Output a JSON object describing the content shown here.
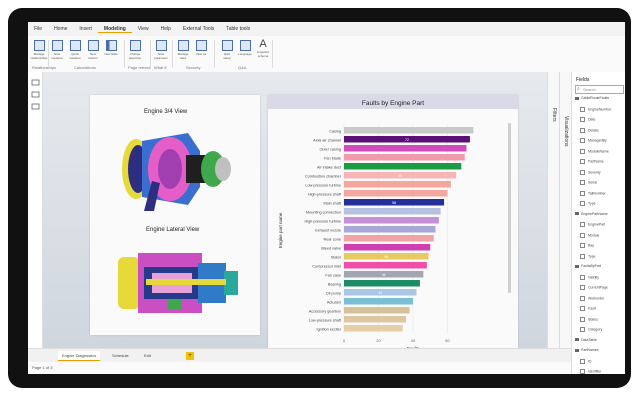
{
  "menu": {
    "items": [
      "File",
      "Home",
      "Insert",
      "Modeling",
      "View",
      "Help",
      "External Tools",
      "Table tools"
    ],
    "active_index": 3
  },
  "ribbon": {
    "buttons": [
      {
        "label": "Manage relationships",
        "icon": "relationships-icon"
      },
      {
        "label": "New measure",
        "icon": "calculator-icon"
      },
      {
        "label": "Quick measure",
        "icon": "calculator-icon"
      },
      {
        "label": "New column",
        "icon": "column-icon"
      },
      {
        "label": "New table",
        "icon": "table-icon"
      },
      {
        "label": "Change detection",
        "icon": "detect-icon"
      },
      {
        "label": "New parameter",
        "icon": "parameter-icon"
      },
      {
        "label": "Manage roles",
        "icon": "roles-icon"
      },
      {
        "label": "View as",
        "icon": "view-icon"
      },
      {
        "label": "Q&A setup",
        "icon": "qa-icon"
      },
      {
        "label": "Language",
        "icon": "language-icon"
      },
      {
        "label": "Linguistic schema",
        "icon": "text-icon"
      }
    ],
    "groups": [
      "Relationships",
      "Calculations",
      "Page refresh",
      "What if",
      "Security",
      "Q&A"
    ]
  },
  "report": {
    "left_card": {
      "title_top": "Engine 3/4 View",
      "title_bottom": "Engine Lateral View"
    }
  },
  "panes": {
    "filters_label": "Filters",
    "visualizations_label": "Visualizations",
    "fields_title": "Fields",
    "search_placeholder": "Search",
    "fields": [
      {
        "name": "CableRouteFaults",
        "kind": "table"
      },
      {
        "name": "EngineNumber",
        "kind": "field"
      },
      {
        "name": "Date",
        "kind": "field"
      },
      {
        "name": "Details",
        "kind": "field"
      },
      {
        "name": "ManagedBy",
        "kind": "field"
      },
      {
        "name": "ModuleName",
        "kind": "field"
      },
      {
        "name": "PartName",
        "kind": "field"
      },
      {
        "name": "Severity",
        "kind": "field"
      },
      {
        "name": "Serial",
        "kind": "field"
      },
      {
        "name": "TailNumber",
        "kind": "field"
      },
      {
        "name": "Type",
        "kind": "field"
      },
      {
        "name": "EnginePartName",
        "kind": "table"
      },
      {
        "name": "EnginePart",
        "kind": "field"
      },
      {
        "name": "Module",
        "kind": "field"
      },
      {
        "name": "Bay",
        "kind": "field"
      },
      {
        "name": "Type",
        "kind": "field"
      },
      {
        "name": "FaultsByPart",
        "kind": "table"
      },
      {
        "name": "Validity",
        "kind": "field"
      },
      {
        "name": "CurrentPage",
        "kind": "field"
      },
      {
        "name": "Workorder",
        "kind": "field"
      },
      {
        "name": "Fault",
        "kind": "field"
      },
      {
        "name": "Status",
        "kind": "field"
      },
      {
        "name": "Category",
        "kind": "field"
      },
      {
        "name": "DataTable",
        "kind": "table"
      },
      {
        "name": "PartNames",
        "kind": "table"
      },
      {
        "name": "ID",
        "kind": "field"
      },
      {
        "name": "Identifier",
        "kind": "field"
      }
    ]
  },
  "tabs": {
    "items": [
      "Engine Diagnostics",
      "Schedule",
      "Edit"
    ],
    "active_index": 0,
    "add_label": "+"
  },
  "status": {
    "page_text": "Page 1 of 3"
  },
  "chart_data": {
    "type": "bar",
    "orientation": "horizontal",
    "title": "Faults by Engine Part",
    "xlabel": "Faults",
    "ylabel": "Engine part name",
    "xlim": [
      0,
      80
    ],
    "x_ticks": [
      0,
      20,
      40,
      60
    ],
    "categories": [
      "Casing",
      "Axial air channel",
      "Outer casing",
      "Fan blade",
      "Air intake duct",
      "Combustion chamber",
      "Low-pressure turbine",
      "High-pressure shaft",
      "Main shaft",
      "Mounting connection",
      "High-pressure turbine",
      "Exhaust nozzle",
      "Rear cone",
      "Bleed valve",
      "Stator",
      "Compressor inlet",
      "Fan case",
      "Bearing",
      "Oil pump",
      "Actuator",
      "Accessory gearbox",
      "Low-pressure shaft",
      "Ignition exciter"
    ],
    "values": [
      75,
      73,
      71,
      70,
      68,
      65,
      62,
      60,
      58,
      56,
      55,
      53,
      52,
      50,
      49,
      48,
      46,
      44,
      42,
      40,
      38,
      36,
      34
    ],
    "data_labels": {
      "1": "72",
      "5": "65",
      "8": "58",
      "14": "49",
      "16": "46",
      "18": "42"
    },
    "colors": [
      "#c8c9cb",
      "#5b1079",
      "#d24bbd",
      "#f29aac",
      "#1c9a46",
      "#f7b5b5",
      "#f5a79c",
      "#f2a8a0",
      "#23309c",
      "#b7c2e0",
      "#c78fd6",
      "#a9a7d8",
      "#f2a4a4",
      "#d03fb2",
      "#e6cc60",
      "#ef4fa8",
      "#a1a6b0",
      "#1e8c63",
      "#a9c6e4",
      "#7bbfd6",
      "#d4c29a",
      "#dcc7a0",
      "#e4cfa9"
    ]
  }
}
